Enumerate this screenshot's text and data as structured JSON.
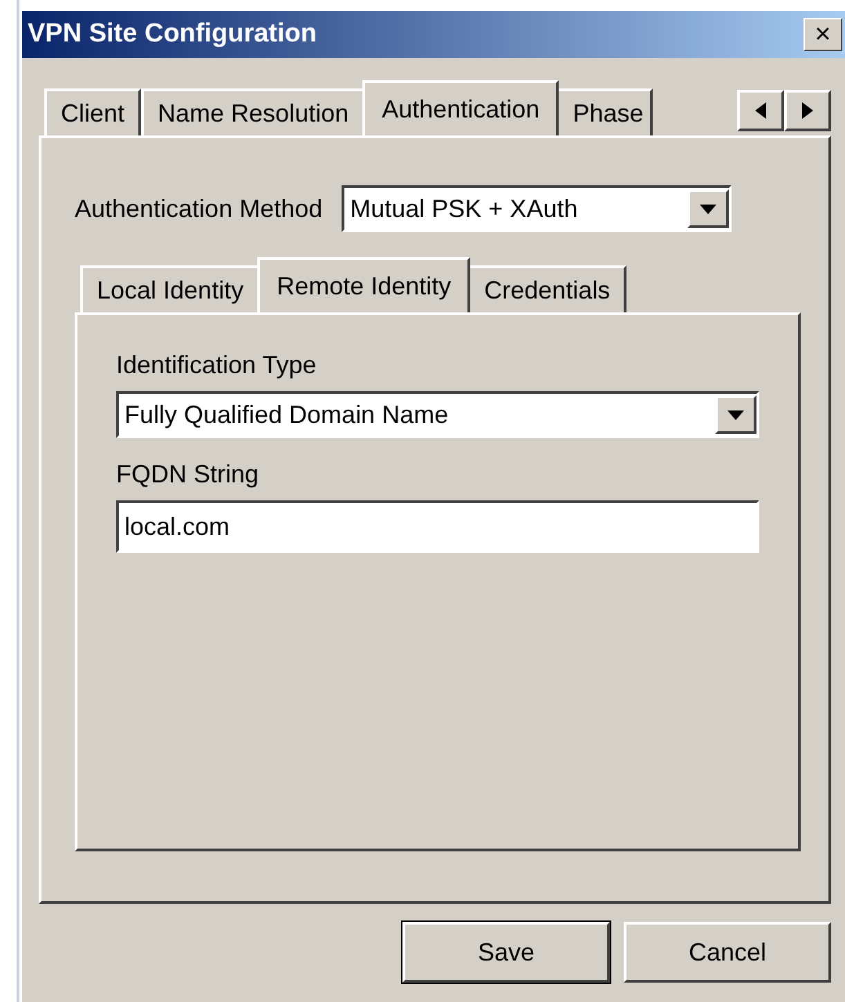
{
  "window": {
    "title": "VPN Site Configuration",
    "close": "×"
  },
  "tabs": [
    {
      "label": "Client",
      "selected": false
    },
    {
      "label": "Name Resolution",
      "selected": false
    },
    {
      "label": "Authentication",
      "selected": true
    },
    {
      "label": "Phase",
      "selected": false
    }
  ],
  "authentication_method": {
    "label": "Authentication Method",
    "value": "Mutual PSK + XAuth"
  },
  "sub_tabs": [
    {
      "label": "Local Identity",
      "selected": false
    },
    {
      "label": "Remote Identity",
      "selected": true
    },
    {
      "label": "Credentials",
      "selected": false
    }
  ],
  "identification_type": {
    "label": "Identification Type",
    "value": "Fully Qualified Domain Name"
  },
  "fqdn_string": {
    "label": "FQDN String",
    "value": "local.com"
  },
  "buttons": [
    {
      "label": "Save",
      "default": true
    },
    {
      "label": "Cancel",
      "default": false
    }
  ]
}
